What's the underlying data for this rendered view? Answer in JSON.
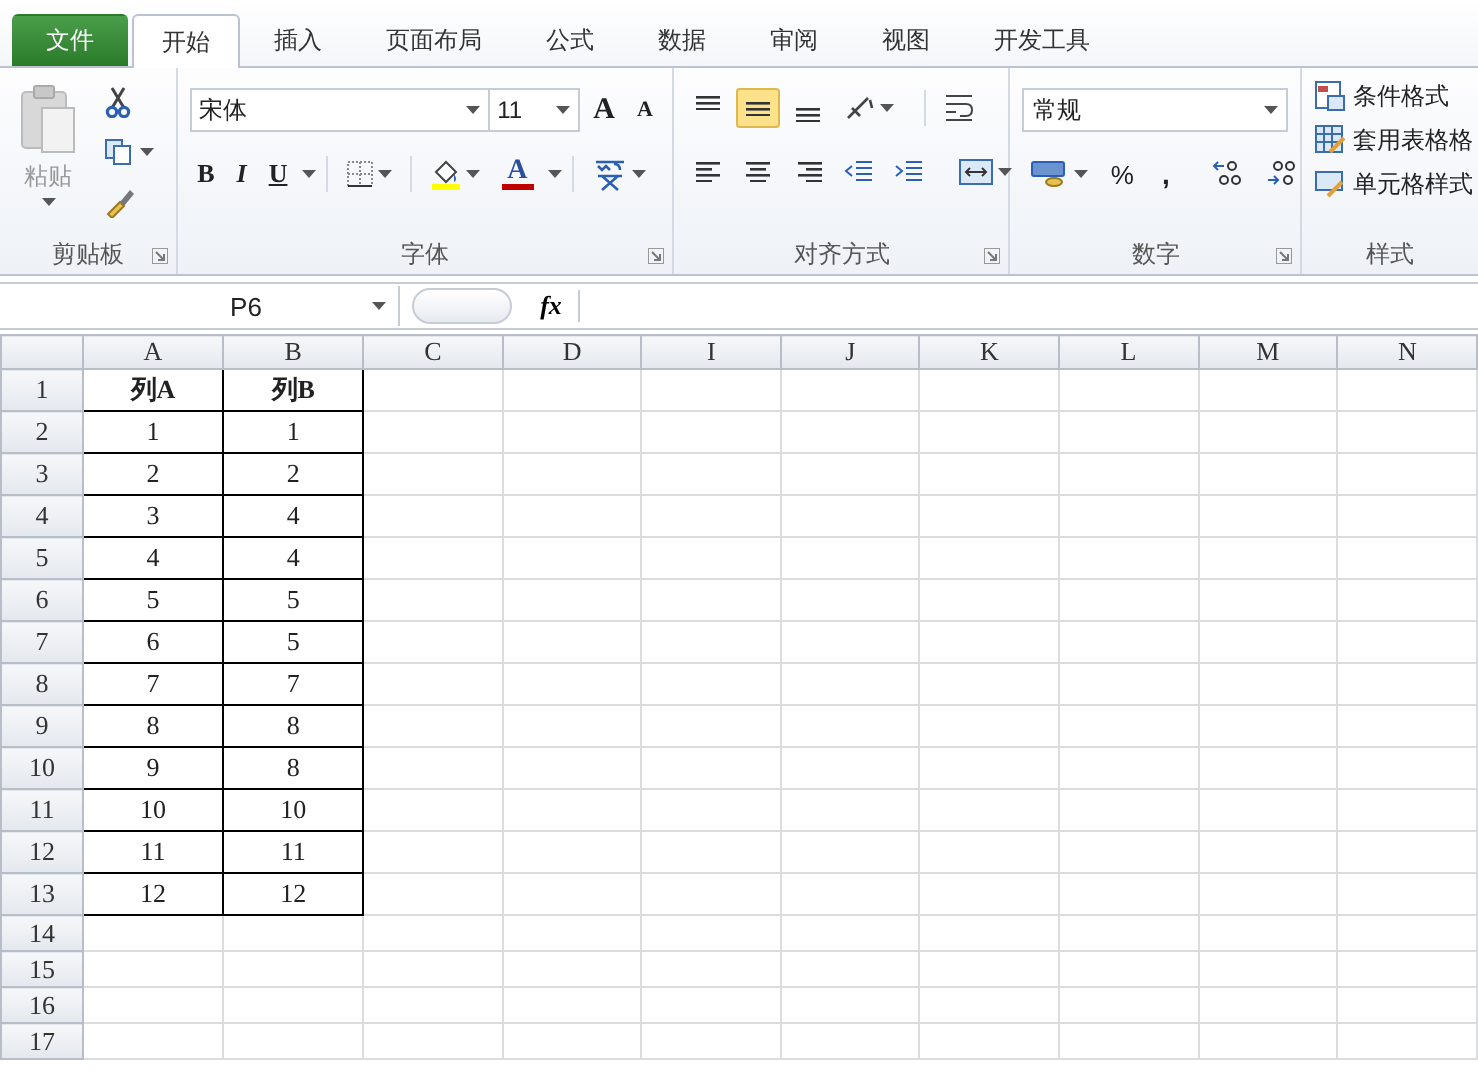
{
  "tabs": [
    {
      "label": "文件",
      "kind": "file",
      "selected": false
    },
    {
      "label": "开始",
      "kind": "tab",
      "selected": true
    },
    {
      "label": "插入",
      "kind": "tab",
      "selected": false
    },
    {
      "label": "页面布局",
      "kind": "tab",
      "selected": false
    },
    {
      "label": "公式",
      "kind": "tab",
      "selected": false
    },
    {
      "label": "数据",
      "kind": "tab",
      "selected": false
    },
    {
      "label": "审阅",
      "kind": "tab",
      "selected": false
    },
    {
      "label": "视图",
      "kind": "tab",
      "selected": false
    },
    {
      "label": "开发工具",
      "kind": "tab",
      "selected": false
    }
  ],
  "clipboard": {
    "paste_label": "粘贴",
    "title": "剪贴板"
  },
  "font": {
    "title": "字体",
    "font_name": "宋体",
    "font_size": "11",
    "grow_label": "A",
    "shrink_label": "A",
    "bold_label": "B",
    "italic_label": "I",
    "underline_label": "U",
    "color_label": "A"
  },
  "alignment": {
    "title": "对齐方式",
    "vertical": [
      {
        "kind": "top",
        "selected": false
      },
      {
        "kind": "middle",
        "selected": true
      },
      {
        "kind": "bottom",
        "selected": false
      }
    ],
    "horizontal": [
      {
        "kind": "left",
        "selected": false
      },
      {
        "kind": "center",
        "selected": false
      },
      {
        "kind": "right",
        "selected": false
      }
    ]
  },
  "number": {
    "title": "数字",
    "format": "常规",
    "percent_label": "%",
    "comma_label": ","
  },
  "styles": {
    "title": "样式",
    "items": [
      {
        "label": "条件格式",
        "kind": "conditional"
      },
      {
        "label": "套用表格格",
        "kind": "table"
      },
      {
        "label": "单元格样式",
        "kind": "cell"
      }
    ]
  },
  "formula_bar": {
    "name_box": "P6",
    "function_label": "fx"
  },
  "sheet": {
    "columns": [
      "A",
      "B",
      "C",
      "D",
      "I",
      "J",
      "K",
      "L",
      "M",
      "N"
    ],
    "rows": [
      {
        "header": "1",
        "bold": true,
        "cells": [
          "列A",
          "列B"
        ]
      },
      {
        "header": "2",
        "bold": false,
        "cells": [
          "1",
          "1"
        ]
      },
      {
        "header": "3",
        "bold": false,
        "cells": [
          "2",
          "2"
        ]
      },
      {
        "header": "4",
        "bold": false,
        "cells": [
          "3",
          "4"
        ]
      },
      {
        "header": "5",
        "bold": false,
        "cells": [
          "4",
          "4"
        ]
      },
      {
        "header": "6",
        "bold": false,
        "cells": [
          "5",
          "5"
        ]
      },
      {
        "header": "7",
        "bold": false,
        "cells": [
          "6",
          "5"
        ]
      },
      {
        "header": "8",
        "bold": false,
        "cells": [
          "7",
          "7"
        ]
      },
      {
        "header": "9",
        "bold": false,
        "cells": [
          "8",
          "8"
        ]
      },
      {
        "header": "10",
        "bold": false,
        "cells": [
          "9",
          "8"
        ]
      },
      {
        "header": "11",
        "bold": false,
        "cells": [
          "10",
          "10"
        ]
      },
      {
        "header": "12",
        "bold": false,
        "cells": [
          "11",
          "11"
        ]
      },
      {
        "header": "13",
        "bold": false,
        "cells": [
          "12",
          "12"
        ]
      },
      {
        "header": "14",
        "cells": []
      },
      {
        "header": "15",
        "cells": []
      },
      {
        "header": "16",
        "cells": []
      },
      {
        "header": "17",
        "cells": []
      }
    ]
  }
}
